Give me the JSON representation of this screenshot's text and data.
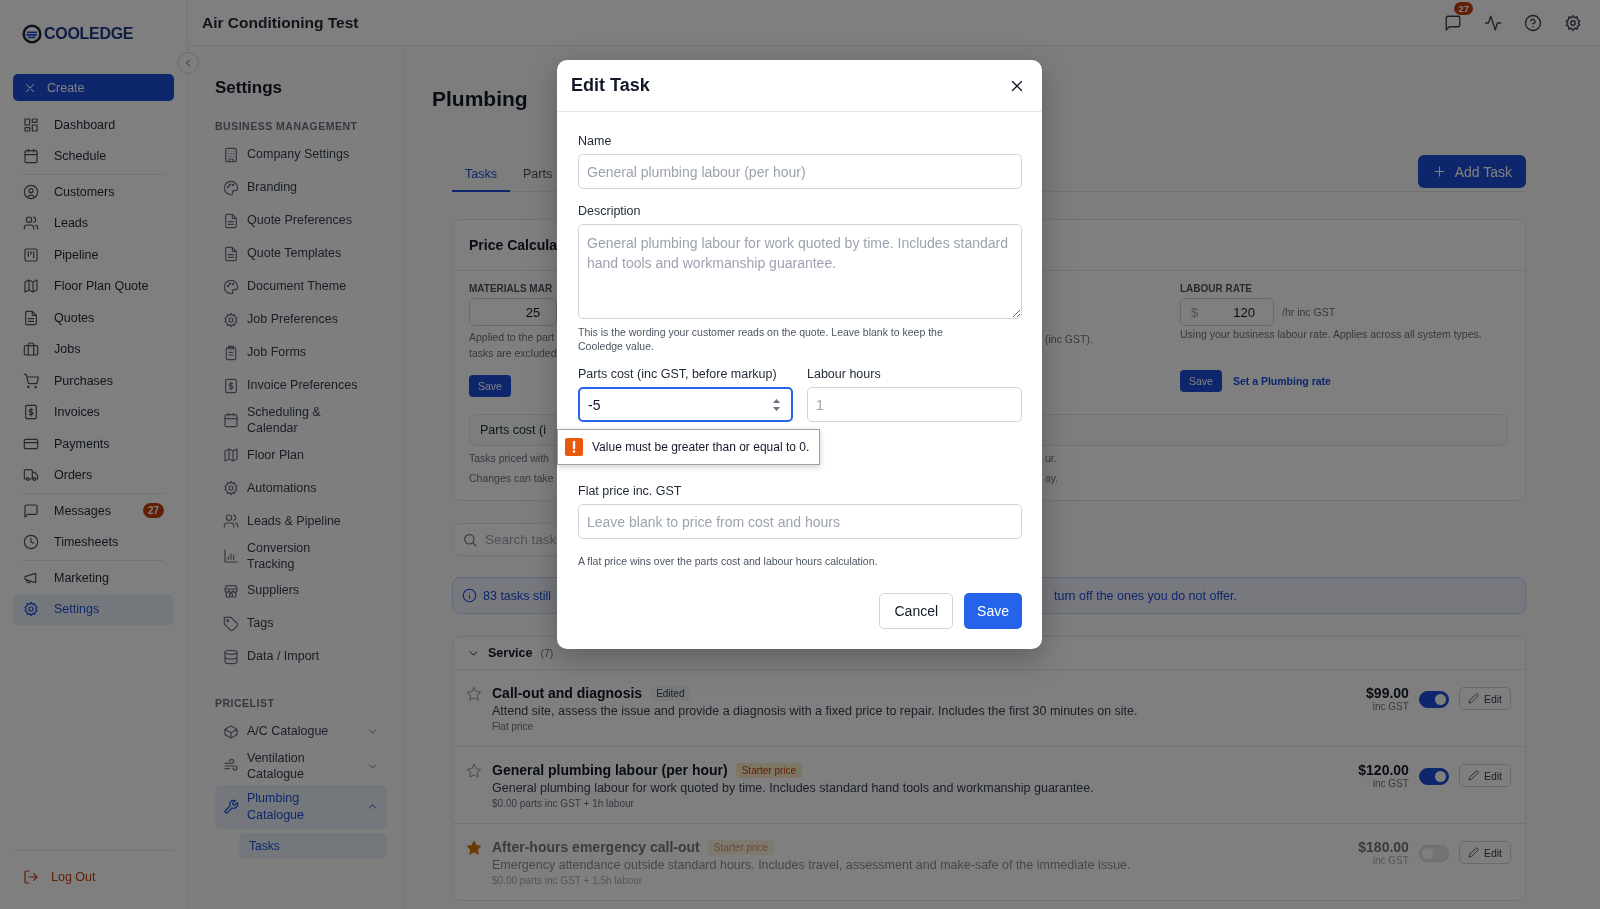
{
  "sidebar": {
    "logo": "COOLEDGE",
    "create_button": "Create",
    "nav_groups": [
      {
        "items": [
          {
            "label": "Dashboard",
            "selected": false
          },
          {
            "label": "Schedule",
            "selected": false
          }
        ]
      },
      {
        "items": [
          {
            "label": "Customers",
            "selected": false
          },
          {
            "label": "Leads",
            "selected": false
          },
          {
            "label": "Pipeline",
            "selected": false
          },
          {
            "label": "Floor Plan Quote",
            "selected": false
          },
          {
            "label": "Quotes",
            "selected": false
          },
          {
            "label": "Jobs",
            "selected": false
          },
          {
            "label": "Purchases",
            "selected": false
          },
          {
            "label": "Invoices",
            "selected": false
          },
          {
            "label": "Payments",
            "selected": false
          },
          {
            "label": "Orders",
            "selected": false
          }
        ]
      },
      {
        "items": [
          {
            "label": "Messages",
            "selected": false,
            "badge": "27"
          },
          {
            "label": "Timesheets",
            "selected": false
          }
        ]
      },
      {
        "items": [
          {
            "label": "Marketing",
            "selected": false
          },
          {
            "label": "Settings",
            "selected": true
          }
        ]
      }
    ],
    "logout": "Log Out"
  },
  "topbar": {
    "title": "Air Conditioning Test",
    "messages_badge": "27"
  },
  "settings_menu": {
    "title": "Settings",
    "sections": [
      {
        "heading": "BUSINESS MANAGEMENT",
        "items": [
          {
            "label": "Company Settings",
            "selected": false
          },
          {
            "label": "Branding",
            "selected": false
          },
          {
            "label": "Quote Preferences",
            "selected": false
          },
          {
            "label": "Quote Templates",
            "selected": false
          },
          {
            "label": "Document Theme",
            "selected": false
          },
          {
            "label": "Job Preferences",
            "selected": false
          },
          {
            "label": "Job Forms",
            "selected": false
          },
          {
            "label": "Invoice Preferences",
            "selected": false
          },
          {
            "label": "Scheduling & Calendar",
            "selected": false
          },
          {
            "label": "Floor Plan",
            "selected": false
          },
          {
            "label": "Automations",
            "selected": false
          },
          {
            "label": "Leads & Pipeline",
            "selected": false
          },
          {
            "label": "Conversion Tracking",
            "selected": false
          },
          {
            "label": "Suppliers",
            "selected": false
          },
          {
            "label": "Tags",
            "selected": false
          },
          {
            "label": "Data / Import",
            "selected": false
          }
        ]
      },
      {
        "heading": "PRICELIST",
        "items": [
          {
            "label": "A/C Catalogue",
            "selected": false,
            "expanded": false
          },
          {
            "label": "Ventilation Catalogue",
            "selected": false,
            "expanded": false
          },
          {
            "label": "Plumbing Catalogue",
            "selected": true,
            "expanded": true,
            "children": [
              {
                "label": "Tasks",
                "selected": true
              }
            ]
          }
        ]
      }
    ]
  },
  "page": {
    "title": "Plumbing",
    "tabs": [
      {
        "label": "Tasks",
        "selected": true
      },
      {
        "label": "Parts",
        "selected": false
      }
    ],
    "add_button": "Add Task",
    "price_card": {
      "title": "Price Calcula",
      "materials_label": "MATERIALS MAR",
      "materials_value": "25",
      "materials_help": [
        "Applied to the part",
        "tasks are excluded"
      ],
      "materials_save": "Save",
      "middle_help": "(inc GST).",
      "labour_label": "LABOUR RATE",
      "labour_prefix": "$",
      "labour_value": "120",
      "labour_suffix": "/hr inc GST",
      "labour_help": "Using your business labour rate. Applies across all system types.",
      "labour_save": "Save",
      "labour_link": "Set a Plumbing rate",
      "mode_select": "Parts cost (i",
      "notes": [
        {
          "left": "Tasks priced with",
          "right": "ur."
        },
        {
          "left": "Changes can take",
          "right": "ay."
        }
      ]
    },
    "search": {
      "placeholder": "Search task"
    },
    "banner": {
      "left": "83 tasks still",
      "right": "turn off the ones you do not offer."
    },
    "task_group": {
      "title": "Service",
      "count": "(7)",
      "expanded": true,
      "tasks": [
        {
          "name": "Call-out and diagnosis",
          "badge": {
            "kind": "edited",
            "label": "Edited"
          },
          "description": "Attend site, assess the issue and provide a diagnosis with a fixed price to repair. Includes the first 30 minutes on site.",
          "meta": "Flat price",
          "price": "$99.00",
          "price_note": "inc GST",
          "favorite": false,
          "on": true,
          "edit": "Edit"
        },
        {
          "name": "General plumbing labour (per hour)",
          "badge": {
            "kind": "starter",
            "label": "Starter price"
          },
          "description": "General plumbing labour for work quoted by time. Includes standard hand tools and workmanship guarantee.",
          "meta": "$0.00 parts inc GST + 1h labour",
          "price": "$120.00",
          "price_note": "inc GST",
          "favorite": false,
          "on": true,
          "edit": "Edit"
        },
        {
          "name": "After-hours emergency call-out",
          "badge": {
            "kind": "starter",
            "label": "Starter price"
          },
          "description": "Emergency attendance outside standard hours. Includes travel, assessment and make-safe of the immediate issue.",
          "meta": "$0.00 parts inc GST + 1.5h labour",
          "price": "$180.00",
          "price_note": "inc GST",
          "favorite": true,
          "on": false,
          "edit": "Edit"
        }
      ]
    }
  },
  "modal": {
    "title": "Edit Task",
    "name_label": "Name",
    "name_placeholder": "General plumbing labour (per hour)",
    "description_label": "Description",
    "description_placeholder": "General plumbing labour for work quoted by time. Includes standard hand tools and workmanship guarantee.",
    "description_help": "This is the wording your customer reads on the quote. Leave blank to keep the Cooledge value.",
    "parts_label": "Parts cost (inc GST, before markup)",
    "parts_value": "-5",
    "labour_label": "Labour hours",
    "labour_placeholder": "1",
    "validation": "Value must be greater than or equal to 0.",
    "flat_label": "Flat price inc. GST",
    "flat_placeholder": "Leave blank to price from cost and hours",
    "flat_help": "A flat price wins over the parts cost and labour hours calculation.",
    "cancel": "Cancel",
    "save": "Save"
  }
}
